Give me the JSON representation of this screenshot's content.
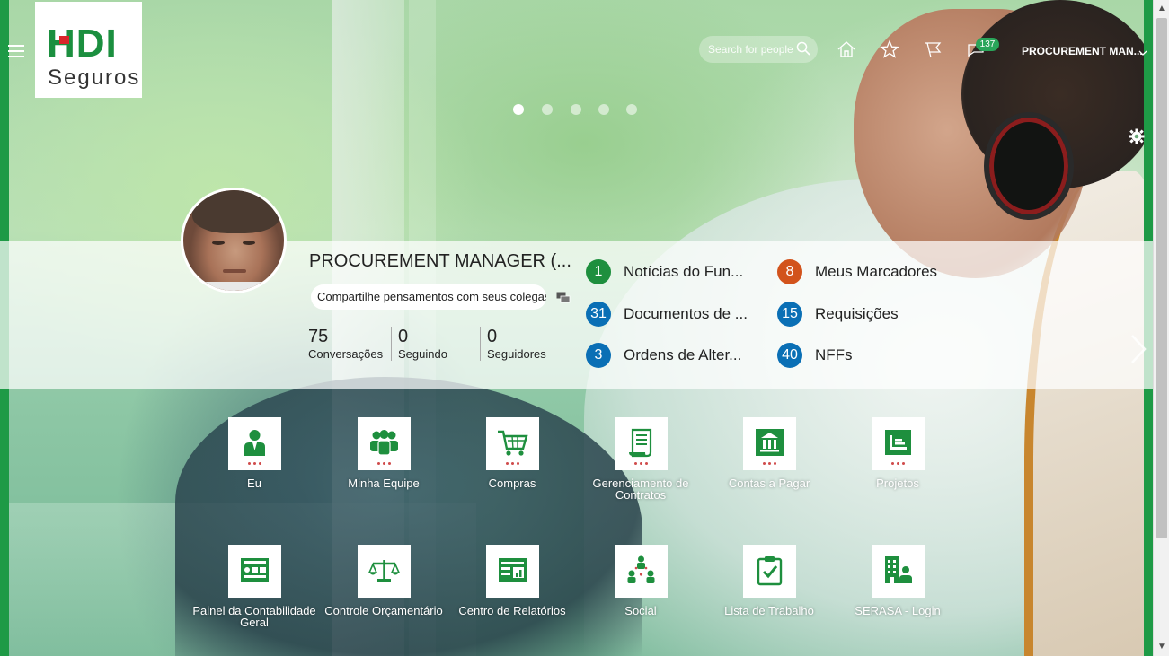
{
  "header": {
    "logo_main": "HDI",
    "logo_sub": "Seguros",
    "search_placeholder": "Search for people",
    "notifications_count": "137",
    "user_name": "PROCUREMENT MAN..."
  },
  "carousel": {
    "pages": 5,
    "active": 0
  },
  "profile": {
    "name": "PROCUREMENT MANAGER (...",
    "share_placeholder": "Compartilhe pensamentos com seus colegas",
    "stats": [
      {
        "value": "75",
        "label": "Conversações"
      },
      {
        "value": "0",
        "label": "Seguindo"
      },
      {
        "value": "0",
        "label": "Seguidores"
      }
    ]
  },
  "counters": [
    {
      "count": "1",
      "label": "Notícias do Fun...",
      "color": "#1e8f3e"
    },
    {
      "count": "8",
      "label": "Meus Marcadores",
      "color": "#d2531c"
    },
    {
      "count": "31",
      "label": "Documentos de ...",
      "color": "#0a6fb5"
    },
    {
      "count": "15",
      "label": "Requisições",
      "color": "#0a6fb5"
    },
    {
      "count": "3",
      "label": "Ordens de Alter...",
      "color": "#0a6fb5"
    },
    {
      "count": "40",
      "label": "NFFs",
      "color": "#0a6fb5"
    }
  ],
  "tiles": [
    {
      "label": "Eu",
      "icon": "person-icon"
    },
    {
      "label": "Minha Equipe",
      "icon": "team-icon"
    },
    {
      "label": "Compras",
      "icon": "shopping-cart-icon"
    },
    {
      "label": "Gerenciamento de Contratos",
      "icon": "contract-scroll-icon"
    },
    {
      "label": "Contas a Pagar",
      "icon": "bank-icon"
    },
    {
      "label": "Projetos",
      "icon": "project-chart-icon"
    },
    {
      "label": "Painel da Contabilidade Geral",
      "icon": "ledger-dashboard-icon"
    },
    {
      "label": "Controle Orçamentário",
      "icon": "scales-icon"
    },
    {
      "label": "Centro de Relatórios",
      "icon": "reports-icon"
    },
    {
      "label": "Social",
      "icon": "social-network-icon"
    },
    {
      "label": "Lista de Trabalho",
      "icon": "clipboard-check-icon"
    },
    {
      "label": "SERASA - Login",
      "icon": "building-person-icon"
    }
  ],
  "colors": {
    "brand_green": "#1e9a46",
    "tile_icon": "#1e8f3e",
    "tile_dots": "#d04b4b"
  }
}
